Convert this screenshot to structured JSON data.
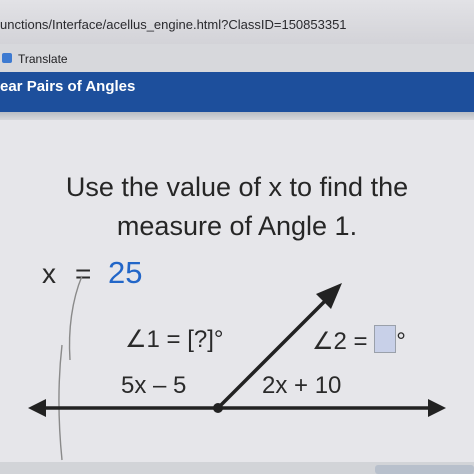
{
  "browser": {
    "url": "unctions/Interface/acellus_engine.html?ClassID=150853351",
    "bookmark_label": "Translate"
  },
  "header": {
    "title": "ear Pairs of Angles"
  },
  "problem": {
    "prompt_line1": "Use the value of x to find the",
    "prompt_line2": "measure of Angle 1.",
    "given_var": "x",
    "given_eq": "=",
    "given_value": "25"
  },
  "diagram": {
    "angle1_prefix": "∠1 = ",
    "angle1_answer": "[?]°",
    "angle2_prefix": "∠2 = ",
    "angle2_suffix": "°",
    "angle1_expr": "5x – 5",
    "angle2_expr": "2x + 10"
  },
  "colors": {
    "header_bg": "#1d4f9c",
    "value_blue": "#2266c8"
  }
}
